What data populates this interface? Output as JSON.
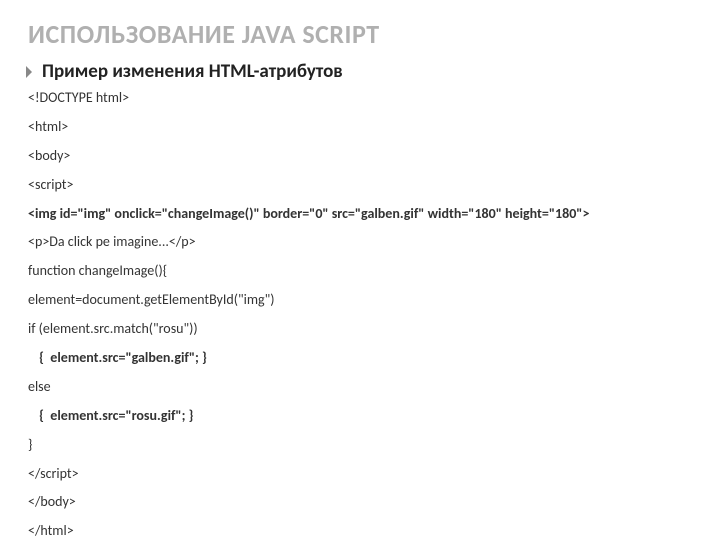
{
  "title": "ИСПОЛЬЗОВАНИЕ JAVA SCRIPT",
  "subtitle": "Пример изменения HTML-атрибутов",
  "code": {
    "l1": "<!DOCTYPE html>",
    "l2": "<html>",
    "l3": "<body>",
    "l4": "<script>",
    "l5": "<img id=\"img\" onclick=\"changeImage()\" border=\"0\" src=\"galben.gif\" width=\"180\" height=\"180\">",
    "l6": "<p>Da click pe imagine...</p>",
    "l7": "function changeImage(){",
    "l8": "element=document.getElementById(\"img\")",
    "l9": "if (element.src.match(\"rosu\"))",
    "l10": " {  element.src=\"galben.gif\"; }",
    "l11": "else",
    "l12": " {  element.src=\"rosu.gif\"; }",
    "l13": "}",
    "l14": "</script>",
    "l15": "</body>",
    "l16": "</html>"
  }
}
